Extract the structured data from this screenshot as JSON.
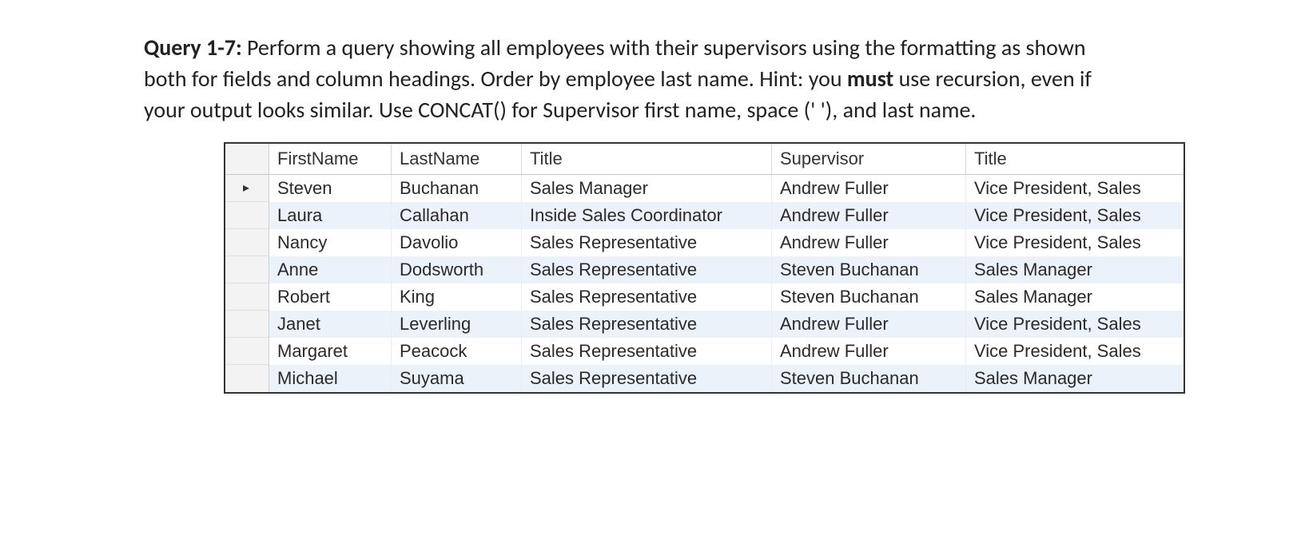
{
  "intro": {
    "bold_label": "Query 1-7: ",
    "part1": "Perform a query showing all employees with their supervisors using the formatting as shown both for fields and column headings. Order by employee last name. Hint: you ",
    "bold_must": "must",
    "part2": " use recursion, even if your output looks similar. Use CONCAT() for Supervisor first name, space (' '), and last name."
  },
  "grid": {
    "row_marker": "▸",
    "headers": [
      "FirstName",
      "LastName",
      "Title",
      "Supervisor",
      "Title"
    ],
    "rows": [
      {
        "first": "Steven",
        "last": "Buchanan",
        "title": "Sales Manager",
        "supervisor": "Andrew Fuller",
        "sup_title": "Vice President, Sales"
      },
      {
        "first": "Laura",
        "last": "Callahan",
        "title": "Inside Sales Coordinator",
        "supervisor": "Andrew Fuller",
        "sup_title": "Vice President, Sales"
      },
      {
        "first": "Nancy",
        "last": "Davolio",
        "title": "Sales Representative",
        "supervisor": "Andrew Fuller",
        "sup_title": "Vice President, Sales"
      },
      {
        "first": "Anne",
        "last": "Dodsworth",
        "title": "Sales Representative",
        "supervisor": "Steven Buchanan",
        "sup_title": "Sales Manager"
      },
      {
        "first": "Robert",
        "last": "King",
        "title": "Sales Representative",
        "supervisor": "Steven Buchanan",
        "sup_title": "Sales Manager"
      },
      {
        "first": "Janet",
        "last": "Leverling",
        "title": "Sales Representative",
        "supervisor": "Andrew Fuller",
        "sup_title": "Vice President, Sales"
      },
      {
        "first": "Margaret",
        "last": "Peacock",
        "title": "Sales Representative",
        "supervisor": "Andrew Fuller",
        "sup_title": "Vice President, Sales"
      },
      {
        "first": "Michael",
        "last": "Suyama",
        "title": "Sales Representative",
        "supervisor": "Steven Buchanan",
        "sup_title": "Sales Manager"
      }
    ]
  }
}
